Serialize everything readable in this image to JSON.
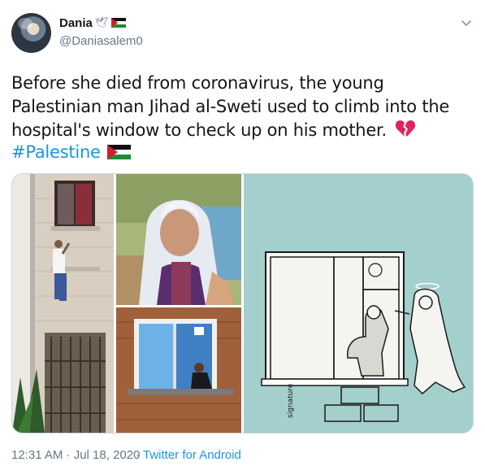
{
  "author": {
    "display_name": "Dania",
    "name_emojis": [
      "dove-icon",
      "palestine-flag-icon"
    ],
    "handle": "@Daniasalem0",
    "avatar": "avatar-photo"
  },
  "tweet": {
    "text": "Before she died from coronavirus, the young Palestinian man Jihad al-Sweti used to climb into the hospital's window to check up on his mother.",
    "text_emoji": "broken-heart-icon",
    "hashtag": "#Palestine",
    "hashtag_emoji": "palestine-flag-icon"
  },
  "media": {
    "photos": [
      {
        "name": "photo-man-climbing-wall",
        "kind": "photograph"
      },
      {
        "name": "photo-elderly-mother",
        "kind": "photograph"
      },
      {
        "name": "photo-man-at-hospital-window",
        "kind": "photograph"
      },
      {
        "name": "cartoon-son-and-angel-mother",
        "kind": "illustration"
      }
    ]
  },
  "footer": {
    "timestamp": "12:31 AM · Jul 18, 2020",
    "separator": "·",
    "source": "Twitter for Android"
  },
  "colors": {
    "text": "#14171a",
    "secondary": "#657786",
    "link": "#1b95e0",
    "border": "#ccd6dd",
    "flag_black": "#111111",
    "flag_green": "#1d8a3a",
    "flag_red": "#d21f2a",
    "broken_heart": "#e0245e",
    "cartoon_background": "#a3cfcd"
  },
  "actions": {
    "more_menu": "chevron-down-icon"
  }
}
